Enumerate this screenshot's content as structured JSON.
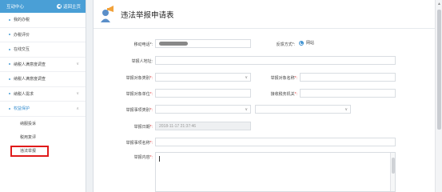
{
  "sidebar": {
    "title": "互动中心",
    "back_label": "返回主页",
    "items": [
      {
        "label": "我的办税",
        "chevron": false
      },
      {
        "label": "办税评价",
        "chevron": false
      },
      {
        "label": "在线交互",
        "chevron": false
      },
      {
        "label": "纳税人满意度调查",
        "chevron": true
      },
      {
        "label": "纳税人满意度调查",
        "chevron": false
      },
      {
        "label": "纳税人需求",
        "chevron": true
      },
      {
        "label": "权益保护",
        "chevron": true,
        "active": true
      }
    ],
    "sub_items": [
      {
        "label": "纳服投诉"
      },
      {
        "label": "税用复评"
      },
      {
        "label": "违法举报",
        "highlight": true
      }
    ]
  },
  "page": {
    "title": "违法举报申请表"
  },
  "form": {
    "mobile_label": "移动电话*:",
    "feedback_label": "反馈方式*:",
    "feedback_option": "网站",
    "reporter_address_label": "举报人地址:",
    "target_type_label": "举报对象类别",
    "target_name_label": "举报对象名称",
    "target_unit_label": "举报对象单位",
    "tax_office_label": "接收税务机关",
    "matter_type_label": "举报事项类别",
    "report_date_label": "举报日期",
    "report_date_value": "2018-11-17 21:37:46",
    "matter_name_label": "举报事项名称",
    "content_label": "举报内容"
  },
  "colors": {
    "accent": "#4a9fd6",
    "required": "#e23333",
    "highlight_box": "#e01a1a"
  }
}
